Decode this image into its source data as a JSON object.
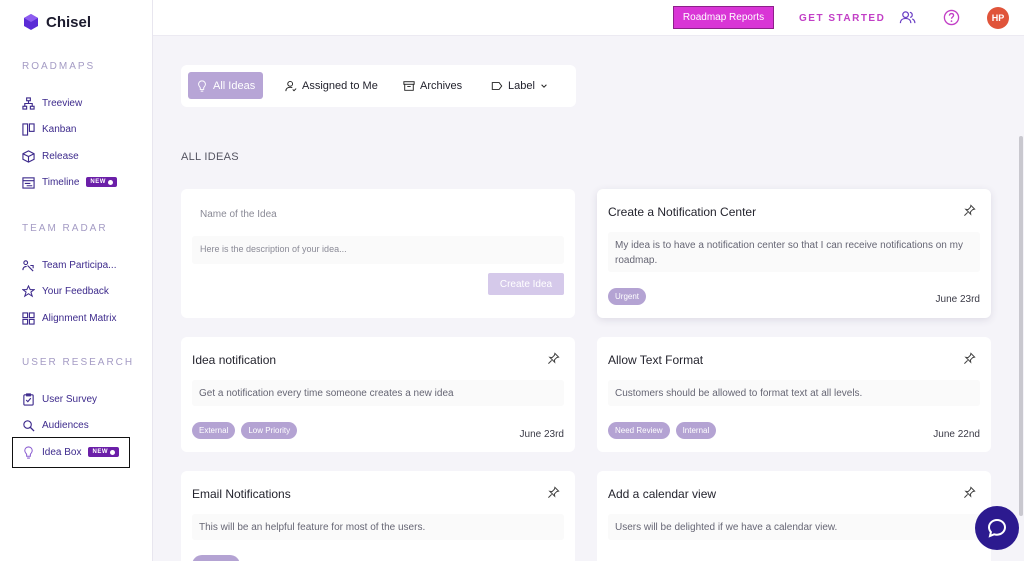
{
  "app": {
    "name": "Chisel"
  },
  "sidebar": {
    "sections": [
      {
        "title": "ROADMAPS",
        "items": [
          {
            "label": "Treeview",
            "icon": "treeview-icon"
          },
          {
            "label": "Kanban",
            "icon": "kanban-icon"
          },
          {
            "label": "Release",
            "icon": "release-icon"
          },
          {
            "label": "Timeline",
            "icon": "timeline-icon",
            "badge": "NEW"
          }
        ]
      },
      {
        "title": "TEAM RADAR",
        "items": [
          {
            "label": "Team Participa...",
            "icon": "team-participation-icon"
          },
          {
            "label": "Your Feedback",
            "icon": "star-icon"
          },
          {
            "label": "Alignment Matrix",
            "icon": "matrix-icon"
          }
        ]
      },
      {
        "title": "USER RESEARCH",
        "items": [
          {
            "label": "User Survey",
            "icon": "survey-icon"
          },
          {
            "label": "Audiences",
            "icon": "audiences-icon"
          },
          {
            "label": "Idea Box",
            "icon": "lightbulb-icon",
            "badge": "NEW",
            "active": true
          }
        ]
      }
    ]
  },
  "topbar": {
    "roadmap_reports": "Roadmap Reports",
    "get_started": "GET STARTED",
    "avatar_initials": "HP"
  },
  "filters": {
    "all_ideas": "All Ideas",
    "assigned_to_me": "Assigned to Me",
    "archives": "Archives",
    "label": "Label"
  },
  "section_title": "ALL IDEAS",
  "new_idea": {
    "name_placeholder": "Name of the Idea",
    "desc_placeholder": "Here is the description of your idea...",
    "create_button": "Create Idea"
  },
  "ideas": [
    {
      "title": "Create a Notification Center",
      "description": "My idea is to have a notification center so that I can receive notifications on my roadmap.",
      "tags": [
        "Urgent"
      ],
      "date": "June 23rd"
    },
    {
      "title": "Idea notification",
      "description": "Get a notification every time someone creates a new idea",
      "tags": [
        "External",
        "Low Priority"
      ],
      "date": "June 23rd"
    },
    {
      "title": "Allow Text Format",
      "description": "Customers should be allowed to format text at all levels.",
      "tags": [
        "Need Review",
        "Internal"
      ],
      "date": "June 22nd"
    },
    {
      "title": "Email Notifications",
      "description": "This will be an helpful feature for most of the users.",
      "tags": [],
      "date": ""
    },
    {
      "title": "Add a calendar view",
      "description": "Users will be delighted if we have a calendar view.",
      "tags": [],
      "date": ""
    }
  ],
  "colors": {
    "brand_purple": "#3d2a8c",
    "accent_magenta": "#d935d6",
    "tag_purple": "#b4a3d3",
    "avatar_orange": "#e0543a"
  }
}
